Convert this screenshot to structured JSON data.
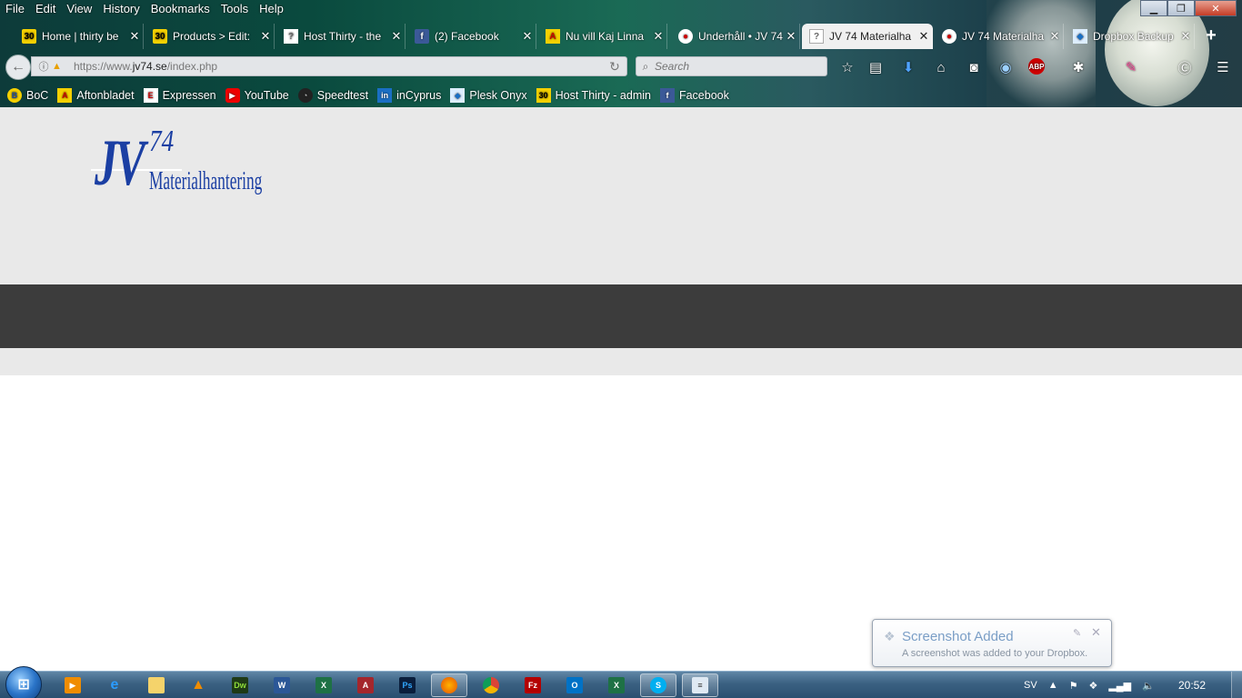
{
  "menu": {
    "items": [
      {
        "label": "File"
      },
      {
        "label": "Edit"
      },
      {
        "label": "View"
      },
      {
        "label": "History"
      },
      {
        "label": "Bookmarks"
      },
      {
        "label": "Tools"
      },
      {
        "label": "Help"
      }
    ]
  },
  "tabs": [
    {
      "label": "Home | thirty be",
      "favicon": "thirty-icon",
      "active": false
    },
    {
      "label": "Products > Edit:",
      "favicon": "thirty-icon",
      "active": false
    },
    {
      "label": "Host Thirty - the",
      "favicon": "page-icon",
      "active": false
    },
    {
      "label": "(2) Facebook",
      "favicon": "facebook-icon",
      "active": false
    },
    {
      "label": "Nu vill Kaj Linna",
      "favicon": "aftonbladet-icon",
      "active": false
    },
    {
      "label": "Underhåll • JV 74",
      "favicon": "jv74-icon",
      "active": false
    },
    {
      "label": "JV 74 Materialha",
      "favicon": "page-icon",
      "active": true
    },
    {
      "label": "JV 74 Materialha",
      "favicon": "jv74-icon",
      "active": false
    },
    {
      "label": "Dropbox Backup",
      "favicon": "dropbox-icon",
      "active": false
    }
  ],
  "navbar": {
    "url_prefix": "https://www.",
    "url_domain": "jv74.se",
    "url_path": "/index.php",
    "search_placeholder": "Search"
  },
  "bookmarks": [
    {
      "label": "BoC",
      "icon": "boc-icon"
    },
    {
      "label": "Aftonbladet",
      "icon": "aftonbladet-icon"
    },
    {
      "label": "Expressen",
      "icon": "expressen-icon"
    },
    {
      "label": "YouTube",
      "icon": "youtube-icon"
    },
    {
      "label": "Speedtest",
      "icon": "speedtest-icon"
    },
    {
      "label": "inCyprus",
      "icon": "incyprus-icon"
    },
    {
      "label": "Plesk Onyx",
      "icon": "plesk-icon"
    },
    {
      "label": "Host Thirty - admin",
      "icon": "thirty-icon"
    },
    {
      "label": "Facebook",
      "icon": "facebook-icon"
    }
  ],
  "page": {
    "logo_letters": "JV",
    "logo_number": "74",
    "logo_subtitle": "Materialhantering",
    "colors": {
      "logo": "#1b3fa3",
      "header_bg": "#e9e9e9",
      "nav_strip": "#3c3c3c"
    }
  },
  "notification": {
    "title": "Screenshot Added",
    "body": "A screenshot was added to your Dropbox."
  },
  "taskbar": {
    "language": "SV",
    "clock": "20:52"
  }
}
